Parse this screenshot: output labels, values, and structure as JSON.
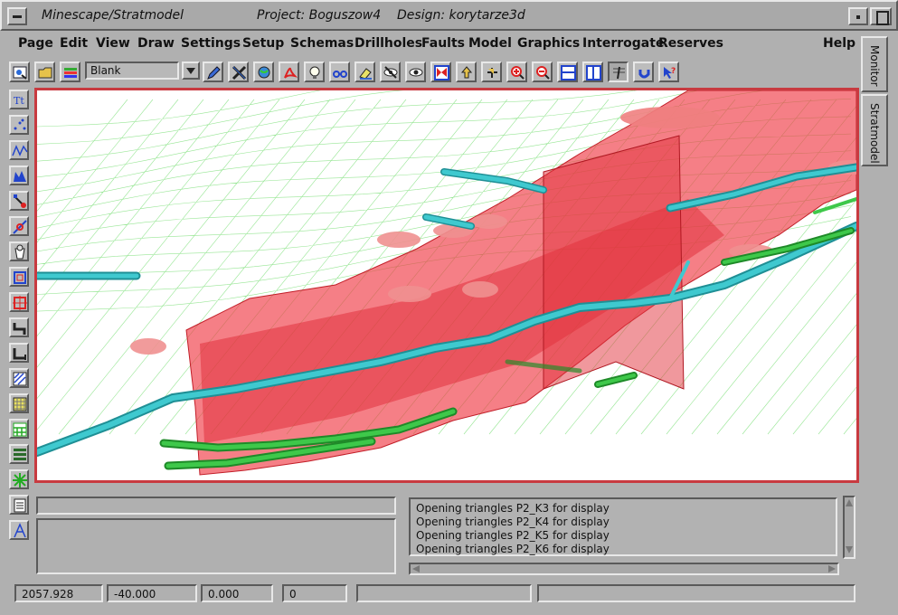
{
  "window": {
    "app_title": "Minescape/Stratmodel",
    "project": "Project: Boguszow4",
    "design": "Design: korytarze3d"
  },
  "menu": [
    "Page",
    "Edit",
    "View",
    "Draw",
    "Settings",
    "Setup",
    "Schemas",
    "Drillholes",
    "Faults",
    "Model",
    "Graphics",
    "Interrogate",
    "Reserves",
    "Help"
  ],
  "toolbar": {
    "layer_select_value": "Blank",
    "icons": [
      "open-plot-icon",
      "open-folder-icon",
      "layers-icon",
      "pencil-icon",
      "cross-tools-icon",
      "globe-icon",
      "pdf-icon",
      "lightbulb-icon",
      "glasses-icon",
      "eraser-icon",
      "hide-eye-icon",
      "eye-icon",
      "frame-icon",
      "upload-icon",
      "pan-icon",
      "zoom-in-icon",
      "zoom-out-icon",
      "horizontal-split-icon",
      "vertical-split-icon",
      "section-icon",
      "undo-icon",
      "help-pointer-icon"
    ]
  },
  "side_tools": [
    "text-tool-icon",
    "points-tool-icon",
    "line-tool-icon",
    "fill-tool-icon",
    "drillhole-tool-icon",
    "fault-tool-icon",
    "bucket-tool-icon",
    "box-tool-icon",
    "box-select-tool-icon",
    "corner-tool-icon",
    "bracket-tool-icon",
    "hatch-tool-icon",
    "grid-tool-icon",
    "grid-alt-tool-icon",
    "stack-tool-icon",
    "star-tool-icon",
    "document-tool-icon",
    "axis-tool-icon"
  ],
  "right_tabs": [
    "Monitor",
    "Stratmodel"
  ],
  "log": [
    "Opening triangles P2_K3 for display",
    "Opening triangles P2_K4 for display",
    "Opening triangles P2_K5 for display",
    "Opening triangles P2_K6 for display"
  ],
  "status": [
    "2057.928",
    "-40.000",
    "0.000",
    "0",
    "",
    ""
  ],
  "colors": {
    "viewport_border": "#c83a40",
    "surface_red": "#ef3b45",
    "tunnel_cyan": "#3fc9cf",
    "tunnel_green": "#3ec84a",
    "mesh_green": "#7ee07a"
  }
}
